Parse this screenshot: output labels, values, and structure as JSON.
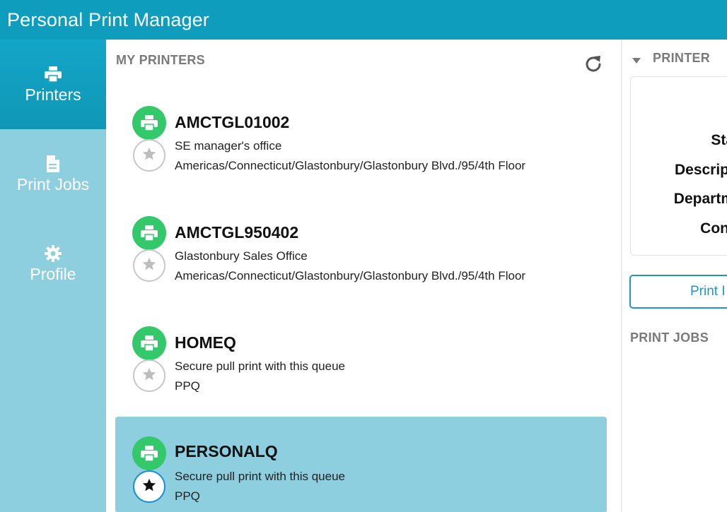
{
  "app": {
    "title": "Personal Print Manager"
  },
  "sidebar": {
    "items": [
      {
        "label": "Printers",
        "icon": "printer-icon",
        "active": true
      },
      {
        "label": "Print Jobs",
        "icon": "document-icon",
        "active": false
      },
      {
        "label": "Profile",
        "icon": "gear-icon",
        "active": false
      }
    ]
  },
  "printers_pane": {
    "header": "MY PRINTERS",
    "refresh_icon": "refresh-icon",
    "items": [
      {
        "name": "AMCTGL01002",
        "description": "SE manager's office",
        "location": "Americas/Connecticut/Glastonbury/Glastonbury Blvd./95/4th Floor",
        "favorite": false,
        "selected": false
      },
      {
        "name": "AMCTGL950402",
        "description": "Glastonbury Sales Office",
        "location": "Americas/Connecticut/Glastonbury/Glastonbury Blvd./95/4th Floor",
        "favorite": false,
        "selected": false
      },
      {
        "name": "HOMEQ",
        "description": "Secure pull print with this queue",
        "location": "PPQ",
        "favorite": false,
        "selected": false
      },
      {
        "name": "PERSONALQ",
        "description": "Secure pull print with this queue",
        "location": "PPQ",
        "favorite": true,
        "selected": true
      }
    ]
  },
  "detail_pane": {
    "header": "PRINTER",
    "fields": [
      "Sta",
      "Descript",
      "Departm",
      "Cont"
    ],
    "print_button": "Print I",
    "jobs_header": "PRINT JOBS"
  },
  "colors": {
    "titlebar": "#0e9dbd",
    "sidebar": "#8dcfde",
    "sidebar_active": "#14a6c7",
    "printer_status": "#33c86a",
    "selected_row": "#8dcfde",
    "accent": "#1f96c4"
  }
}
